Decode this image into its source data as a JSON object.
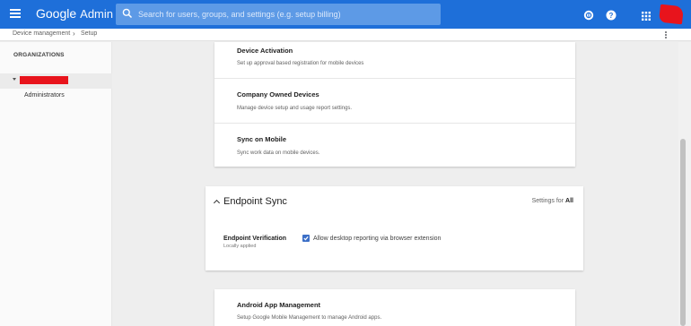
{
  "header": {
    "logo_google": "Google",
    "logo_admin": "Admin",
    "search_placeholder": "Search for users, groups, and settings (e.g. setup billing)",
    "brand_color": "#1e6fd9",
    "icons": [
      "menu-icon",
      "search-icon",
      "support-icon",
      "help-icon",
      "apps-grid-icon"
    ]
  },
  "breadcrumb": {
    "items": [
      "Device management",
      "Setup"
    ],
    "separator": "›"
  },
  "sidebar": {
    "title": "ORGANIZATIONS",
    "child": "Administrators"
  },
  "sections_top": [
    {
      "title": "Device Activation",
      "desc": "Set up approval based registration for mobile devices"
    },
    {
      "title": "Company Owned Devices",
      "desc": "Manage device setup and usage report settings."
    },
    {
      "title": "Sync on Mobile",
      "desc": "Sync work data on mobile devices."
    }
  ],
  "endpoint_sync": {
    "title": "Endpoint Sync",
    "settings_for_label": "Settings for",
    "settings_for_value": "All",
    "verification_label": "Endpoint Verification",
    "verification_sub": "Locally applied",
    "checkbox_label": "Allow desktop reporting via browser extension",
    "checkbox_checked": true
  },
  "android": {
    "title": "Android App Management",
    "desc": "Setup Google Mobile Management to manage Android apps."
  }
}
